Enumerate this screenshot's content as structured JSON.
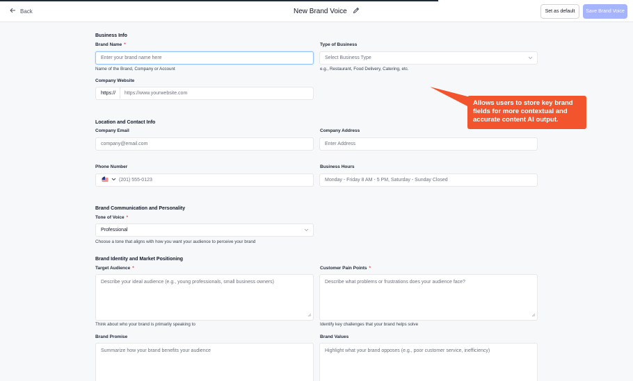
{
  "header": {
    "back_label": "Back",
    "title": "New Brand Voice",
    "set_default_label": "Set as default",
    "save_label": "Save Brand Voice"
  },
  "business_info": {
    "section_title": "Business Info",
    "brand_name": {
      "label": "Brand Name",
      "required": "*",
      "placeholder": "Enter your brand name here",
      "helper": "Name of the Brand, Company or Account"
    },
    "type_of_business": {
      "label": "Type of Business",
      "placeholder": "Select Business Type",
      "helper": "e.g., Restaurant, Food Delivery, Catering, etc."
    },
    "company_website": {
      "label": "Company Website",
      "prefix": "https://",
      "placeholder": "https://www.yourwebsite.com"
    }
  },
  "location_contact": {
    "section_title": "Location and Contact Info",
    "company_email": {
      "label": "Company Email",
      "placeholder": "company@email.com"
    },
    "company_address": {
      "label": "Company Address",
      "placeholder": "Enter Address"
    },
    "phone_number": {
      "label": "Phone Number",
      "placeholder": "(201) 555-0123"
    },
    "business_hours": {
      "label": "Business Hours",
      "placeholder": "Monday - Friday 8 AM - 5 PM, Saturday - Sunday Closed"
    }
  },
  "communication": {
    "section_title": "Brand Communication and Personality",
    "tone_of_voice": {
      "label": "Tone of Voice",
      "required": "*",
      "value": "Professional",
      "helper": "Choose a tone that aligns with how you want your audience to perceive your brand"
    }
  },
  "identity": {
    "section_title": "Brand Identity and Market Positioning",
    "target_audience": {
      "label": "Target Audience",
      "required": "*",
      "placeholder": "Describe your ideal audience (e.g., young professionals, small business owners)",
      "helper": "Think about who your brand is primarily speaking to"
    },
    "pain_points": {
      "label": "Customer Pain Points",
      "required": "*",
      "placeholder": "Describe what problems or frustrations does your audience face?",
      "helper": "Identify key challenges that your brand helps solve"
    },
    "brand_promise": {
      "label": "Brand Promise",
      "placeholder": "Summarize how your brand benefits your audience"
    },
    "brand_values": {
      "label": "Brand Values",
      "placeholder": "Highlight what your brand opposes (e.g., poor customer service, inefficiency)"
    }
  },
  "callout": {
    "text": "Allows users to store key brand fields for more contextual and accurate content AI output."
  },
  "colors": {
    "accent": "#a5b4fc",
    "callout": "#f2542d",
    "required": "#ef4444"
  }
}
